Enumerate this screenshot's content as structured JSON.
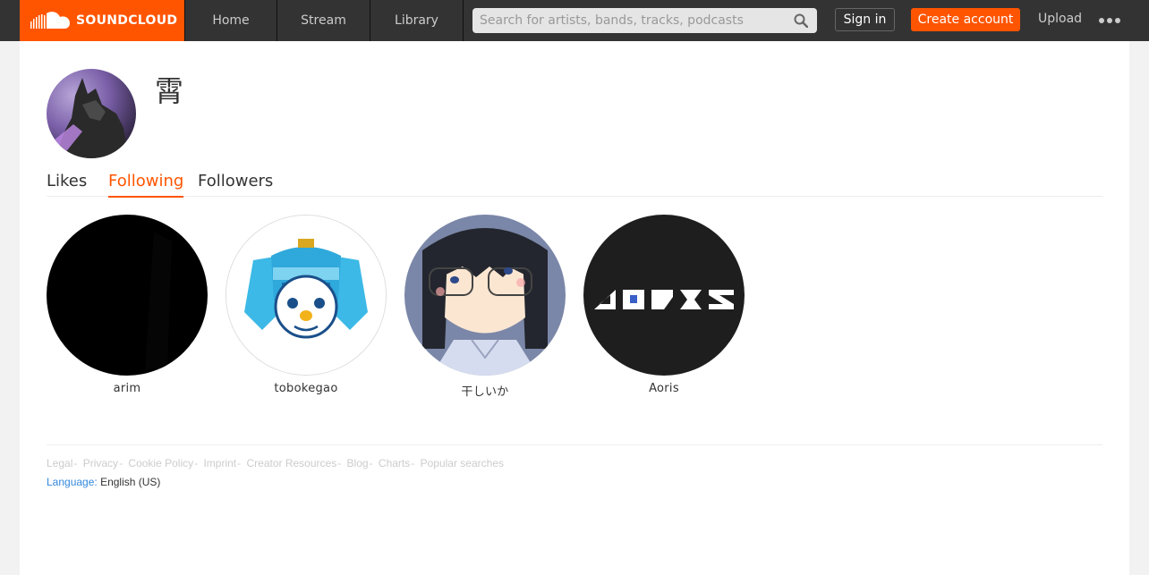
{
  "brand": {
    "name": "SOUNDCLOUD",
    "accent": "#ff5500"
  },
  "nav": [
    {
      "label": "Home"
    },
    {
      "label": "Stream"
    },
    {
      "label": "Library"
    }
  ],
  "search": {
    "placeholder": "Search for artists, bands, tracks, podcasts",
    "icon": "search-icon"
  },
  "header_actions": {
    "signin": "Sign in",
    "create": "Create account",
    "upload": "Upload",
    "more_icon": "more-icon"
  },
  "profile": {
    "username": "霄"
  },
  "tabs": [
    {
      "label": "Likes",
      "active": false
    },
    {
      "label": "Following",
      "active": true
    },
    {
      "label": "Followers",
      "active": false
    }
  ],
  "following": [
    {
      "name": "arim"
    },
    {
      "name": "tobokegao"
    },
    {
      "name": "干しいか"
    },
    {
      "name": "Aoris"
    }
  ],
  "footer": {
    "links": [
      "Legal",
      "Privacy",
      "Cookie Policy",
      "Imprint",
      "Creator Resources",
      "Blog",
      "Charts",
      "Popular searches"
    ],
    "language_label": "Language:",
    "language_value": "English (US)"
  }
}
